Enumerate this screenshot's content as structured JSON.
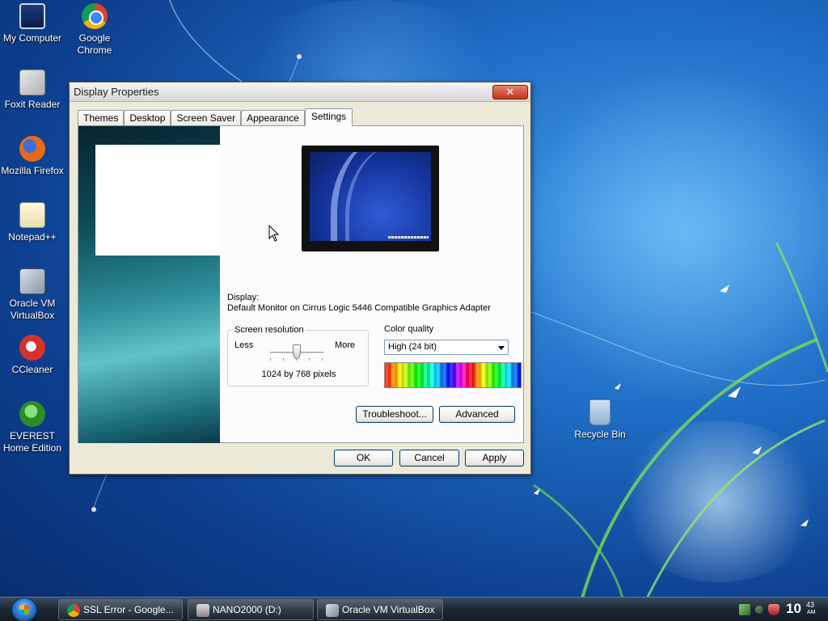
{
  "desktop": {
    "icons": [
      {
        "label": "My Computer",
        "icon": "computer-icon"
      },
      {
        "label": "Google\nChrome",
        "icon": "chrome-icon"
      },
      {
        "label": "Foxit Reader",
        "icon": "foxit-reader-icon"
      },
      {
        "label": "Mozilla Firefox",
        "icon": "firefox-icon"
      },
      {
        "label": "Notepad++",
        "icon": "notepad-icon"
      },
      {
        "label": "Oracle VM\nVirtualBox",
        "icon": "virtualbox-icon"
      },
      {
        "label": "CCleaner",
        "icon": "ccleaner-icon"
      },
      {
        "label": "EVEREST\nHome Edition",
        "icon": "everest-icon"
      },
      {
        "label": "Recycle Bin",
        "icon": "recycle-bin-icon"
      }
    ]
  },
  "window": {
    "title": "Display Properties",
    "close_label": "✕",
    "tabs": [
      "Themes",
      "Desktop",
      "Screen Saver",
      "Appearance",
      "Settings"
    ],
    "active_tab": "Settings",
    "display_label": "Display:",
    "display_value": "Default Monitor on Cirrus Logic 5446 Compatible Graphics Adapter",
    "resolution": {
      "legend": "Screen resolution",
      "less": "Less",
      "more": "More",
      "value_text": "1024 by 768 pixels"
    },
    "color_quality": {
      "legend": "Color quality",
      "selected": "High (24 bit)"
    },
    "buttons": {
      "troubleshoot": "Troubleshoot...",
      "advanced": "Advanced",
      "ok": "OK",
      "cancel": "Cancel",
      "apply": "Apply"
    }
  },
  "taskbar": {
    "tasks": [
      {
        "label": "SSL Error - Google...",
        "icon": "chrome-icon"
      },
      {
        "label": "NANO2000 (D:)",
        "icon": "drive-icon"
      },
      {
        "label": "Oracle VM VirtualBox",
        "icon": "virtualbox-icon"
      }
    ],
    "clock": {
      "hour": "10",
      "minute": "43",
      "ampm": "AM"
    }
  },
  "colors": {
    "titlebar": "#e4e4e4",
    "close_button": "#c33620",
    "window_bg": "#ece9d8",
    "panel_bg": "#fcfcfe",
    "taskbar": "#1d2736"
  }
}
